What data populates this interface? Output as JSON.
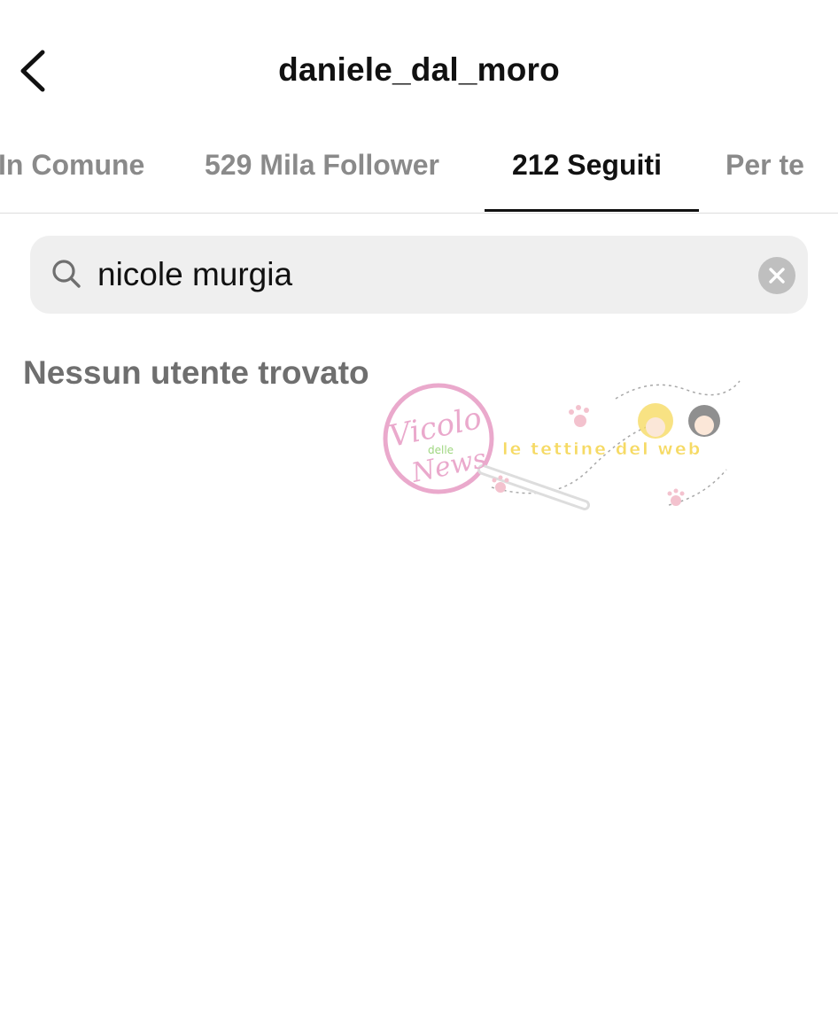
{
  "header": {
    "title": "daniele_dal_moro",
    "back_icon": "chevron-left-icon"
  },
  "tabs": [
    {
      "label": "In Comune",
      "active": false
    },
    {
      "label": "529 Mila Follower",
      "active": false
    },
    {
      "label": "212 Seguiti",
      "active": true
    },
    {
      "label": "Per te",
      "active": false
    }
  ],
  "search": {
    "icon": "search-icon",
    "value": "nicole murgia",
    "clear_icon": "clear-icon"
  },
  "results": {
    "empty_message": "Nessun utente trovato"
  },
  "watermark": {
    "brand_line1": "Vicolo",
    "brand_line2": "delle",
    "brand_line3": "News",
    "tagline": "le tettine del web",
    "colors": {
      "pink": "#e79bc4",
      "green": "#8fd06a",
      "yellow": "#f5d44a"
    }
  }
}
